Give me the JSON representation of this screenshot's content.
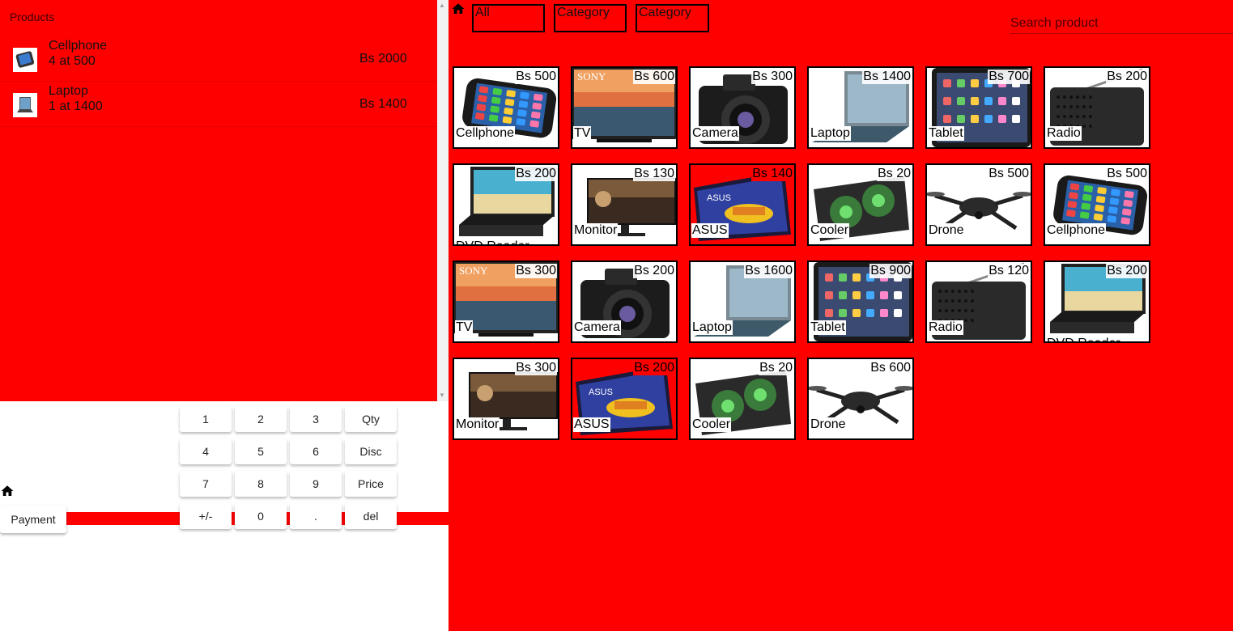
{
  "order": {
    "title": "Products",
    "lines": [
      {
        "name": "Cellphone",
        "detail": "4 at 500",
        "total": "Bs 2000",
        "icon": "cellphone-icon"
      },
      {
        "name": "Laptop",
        "detail": "1 at 1400",
        "total": "Bs 1400",
        "icon": "laptop-icon"
      }
    ]
  },
  "keypad": {
    "keys": [
      "1",
      "2",
      "3",
      "Qty",
      "4",
      "5",
      "6",
      "Disc",
      "7",
      "8",
      "9",
      "Price",
      "+/-",
      "0",
      ".",
      "del"
    ]
  },
  "payment": {
    "label": "Payment"
  },
  "filters": {
    "all": "All",
    "category1": "Category",
    "category2": "Category"
  },
  "search": {
    "placeholder": "Search product"
  },
  "colors": {
    "background": "#ff0000",
    "tile_border": "#000000",
    "key_bg": "#ffffff"
  },
  "products": [
    {
      "name": "Cellphone",
      "price": "Bs 500",
      "art": "cellphone"
    },
    {
      "name": "TV",
      "price": "Bs 600",
      "art": "tv"
    },
    {
      "name": "Camera",
      "price": "Bs 300",
      "art": "camera"
    },
    {
      "name": "Laptop",
      "price": "Bs 1400",
      "art": "laptop"
    },
    {
      "name": "Tablet",
      "price": "Bs 700",
      "art": "tablet"
    },
    {
      "name": "Radio",
      "price": "Bs 200",
      "art": "radio"
    },
    {
      "name": "DVD Reader",
      "price": "Bs 200",
      "art": "dvd"
    },
    {
      "name": "Monitor",
      "price": "Bs 130",
      "art": "monitor"
    },
    {
      "name": "ASUS",
      "price": "Bs 140",
      "art": "asus"
    },
    {
      "name": "Cooler",
      "price": "Bs 20",
      "art": "cooler"
    },
    {
      "name": "Drone",
      "price": "Bs 500",
      "art": "drone"
    },
    {
      "name": "Cellphone",
      "price": "Bs 500",
      "art": "cellphone"
    },
    {
      "name": "TV",
      "price": "Bs 300",
      "art": "tv"
    },
    {
      "name": "Camera",
      "price": "Bs 200",
      "art": "camera"
    },
    {
      "name": "Laptop",
      "price": "Bs 1600",
      "art": "laptop"
    },
    {
      "name": "Tablet",
      "price": "Bs 900",
      "art": "tablet"
    },
    {
      "name": "Radio",
      "price": "Bs 120",
      "art": "radio"
    },
    {
      "name": "DVD Reader",
      "price": "Bs 200",
      "art": "dvd"
    },
    {
      "name": "Monitor",
      "price": "Bs 300",
      "art": "monitor"
    },
    {
      "name": "ASUS",
      "price": "Bs 200",
      "art": "asus"
    },
    {
      "name": "Cooler",
      "price": "Bs 20",
      "art": "cooler"
    },
    {
      "name": "Drone",
      "price": "Bs 600",
      "art": "drone"
    }
  ]
}
